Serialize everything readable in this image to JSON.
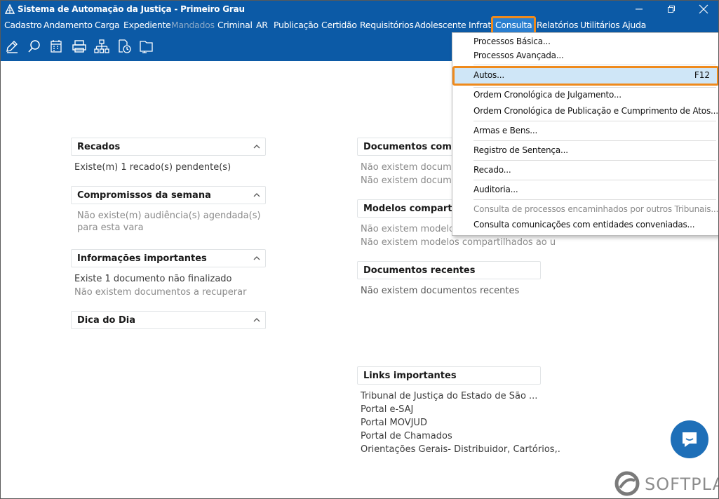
{
  "window": {
    "title": "Sistema de Automação da Justiça - Primeiro Grau"
  },
  "menubar": {
    "items": [
      {
        "label": "Cadastro"
      },
      {
        "label": "Andamento"
      },
      {
        "label": "Carga"
      },
      {
        "label": "Expediente"
      },
      {
        "label": "Mandados",
        "disabled": true
      },
      {
        "label": "Criminal"
      },
      {
        "label": "AR"
      },
      {
        "label": "Publicação"
      },
      {
        "label": "Certidão"
      },
      {
        "label": "Requisitórios"
      },
      {
        "label": "Adolescente Infrator"
      },
      {
        "label": "Consulta",
        "active": true
      },
      {
        "label": "Relatórios"
      },
      {
        "label": "Utilitários"
      },
      {
        "label": "Ajuda"
      }
    ]
  },
  "toolbar": {
    "icons": [
      "edit-icon",
      "search-icon",
      "calendar-icon",
      "printer-icon",
      "hierarchy-icon",
      "document-clock-icon",
      "folder-icon"
    ]
  },
  "left_panels": {
    "recados": {
      "title": "Recados",
      "lines": [
        "Existe(m) 1 recado(s) pendente(s)"
      ]
    },
    "compromissos": {
      "title": "Compromissos da semana",
      "lines": [
        "Não existe(m) audiência(s) agendada(s)",
        "para esta vara"
      ]
    },
    "informacoes": {
      "title": "Informações importantes",
      "lines": [
        "Existe 1 documento não finalizado",
        "Não existem documentos a recuperar"
      ]
    },
    "dica": {
      "title": "Dica do Dia"
    }
  },
  "right_panels": {
    "docs_compartilhados": {
      "title": "Documentos compa",
      "lines": [
        "Não existem documen",
        "Não existem documen"
      ]
    },
    "modelos": {
      "title": "Modelos compartilha",
      "lines": [
        "Não existem modelos",
        "Não existem modelos compartilhados ao u"
      ]
    },
    "recentes": {
      "title": "Documentos recentes",
      "lines": [
        "Não existem documentos recentes"
      ]
    },
    "links": {
      "title": "Links importantes",
      "lines": [
        "Tribunal de Justiça do Estado de São ...",
        "Portal e-SAJ",
        "Portal MOVJUD",
        "Portal de Chamados",
        "Orientações Gerais- Distribuidor, Cartórios,."
      ]
    }
  },
  "dropdown": {
    "items": {
      "basica": "Processos Básica...",
      "avancada": "Processos Avançada...",
      "autos": "Autos...",
      "autos_shortcut": "F12",
      "julgamento": "Ordem Cronológica de Julgamento...",
      "publicacao": "Ordem Cronológica de Publicação e Cumprimento de Atos...",
      "armas": "Armas e Bens...",
      "sentenca": "Registro de Sentença...",
      "recado": "Recado...",
      "auditoria": "Auditoria...",
      "encaminhados": "Consulta de processos encaminhados por outros Tribunais...",
      "comunicacoes": "Consulta comunicações com entidades conveniadas..."
    }
  },
  "brand": {
    "name": "SOFTPLAN"
  },
  "colors": {
    "topbar": "#0c5aa6",
    "highlight_border": "#ef8a1c",
    "highlight_fill": "#cfe6f7",
    "chat": "#1e6fb8"
  }
}
